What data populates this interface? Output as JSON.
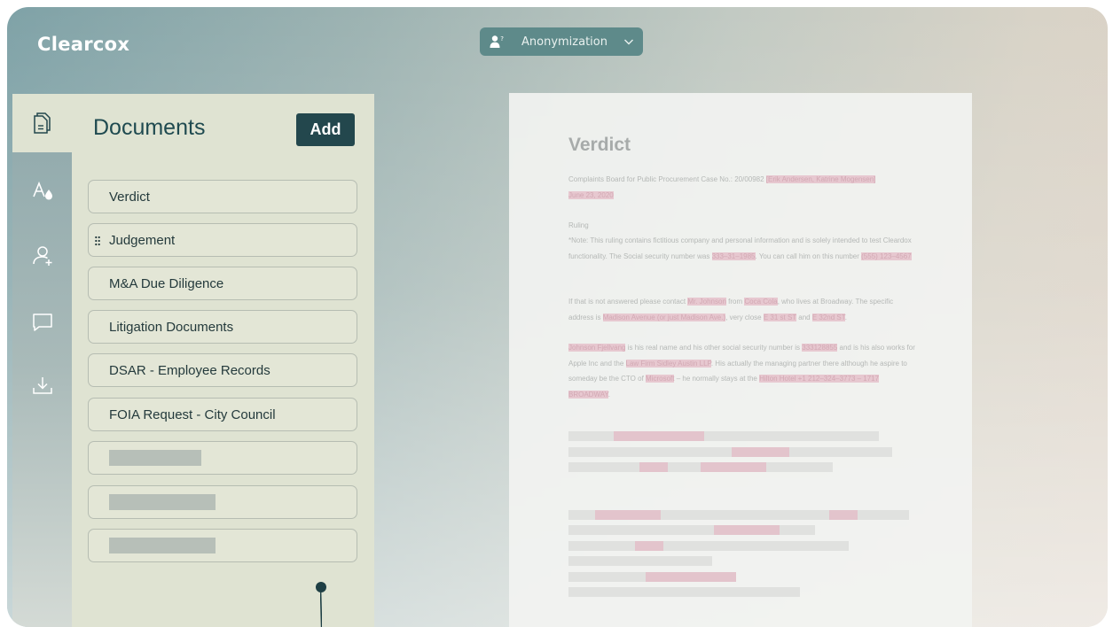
{
  "app": {
    "logo": "Clearcox",
    "mode": "Anonymization"
  },
  "rail": {
    "items": [
      {
        "name": "documents"
      },
      {
        "name": "font-style"
      },
      {
        "name": "add-person"
      },
      {
        "name": "comments"
      },
      {
        "name": "download"
      }
    ]
  },
  "panel": {
    "title": "Documents",
    "add_label": "Add",
    "documents": [
      "Verdict",
      "Judgement",
      "M&A Due Diligence",
      "Litigation Documents",
      "DSAR - Employee Records",
      "FOIA Request - City Council"
    ]
  },
  "document": {
    "title": "Verdict",
    "header_pre": "Complaints Board for Public Procurement Case No.: 20/00982 ",
    "header_names": "[Erik Andersen, Katrine Mogensen]",
    "header_date": "June 23, 2020",
    "ruling": "Ruling",
    "note_pre": "*Note: This ruling contains fictitious company and personal information and is solely intended to test Cleardox functionality. The Social security number was ",
    "note_ssn": "333–31–1985",
    "note_mid": ". You can call him on this number ",
    "note_phone": "(555) 123–4567",
    "p2_a": "If that is not answered please contact ",
    "p2_name": "Mr. Johnson",
    "p2_b": " from ",
    "p2_company": "Coca Cola",
    "p2_c": ", who lives at Broadway. The specific address is ",
    "p2_address": "Madison Avenue (or just Madison Ave.)",
    "p2_d": ", very close ",
    "p2_street1": "E 31 st ST",
    "p2_e": " and ",
    "p2_street2": "E 32nd ST",
    "p2_f": ".",
    "p3_name": "Johnson Fjellvang",
    "p3_a": " is his real name and his other social security number is ",
    "p3_ssn": "333128855",
    "p3_b": " and is his also works for Apple Inc and the ",
    "p3_firm": "Law Firm Sidley Austin LLP",
    "p3_c": ". His actually the managing partner there although he aspire to someday be the CTO of ",
    "p3_company": "Microsoft",
    "p3_d": " – he normally stays at the ",
    "p3_hotel": "Hilton Hotel +1 212–324–3773 – 1717 BROADWAY",
    "p3_e": "."
  }
}
